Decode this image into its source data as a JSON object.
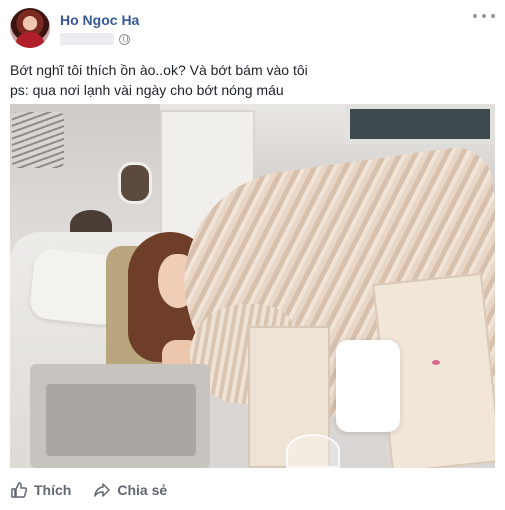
{
  "post": {
    "author": "Ho Ngoc Ha",
    "lines": [
      "Bớt nghĩ tôi thích ồn ào..ok? Và bớt bám vào tôi",
      "ps: qua nơi lạnh vài ngày cho bớt nóng máu"
    ]
  },
  "actions": {
    "like_label": "Thích",
    "share_label": "Chia sẻ"
  },
  "icons": {
    "like": "thumbs-up-icon",
    "share": "share-arrow-icon",
    "privacy": "globe-icon",
    "more": "more-options-icon"
  },
  "colors": {
    "author_link": "#365899",
    "action_text": "#606770"
  }
}
